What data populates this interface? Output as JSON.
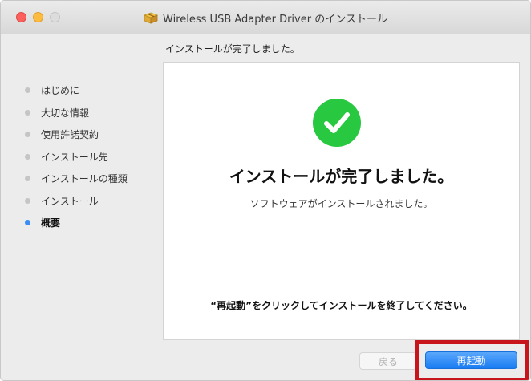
{
  "window": {
    "title": "Wireless USB Adapter Driver のインストール"
  },
  "header": {
    "text": "インストールが完了しました。"
  },
  "sidebar": {
    "items": [
      {
        "label": "はじめに",
        "active": false
      },
      {
        "label": "大切な情報",
        "active": false
      },
      {
        "label": "使用許諾契約",
        "active": false
      },
      {
        "label": "インストール先",
        "active": false
      },
      {
        "label": "インストールの種類",
        "active": false
      },
      {
        "label": "インストール",
        "active": false
      },
      {
        "label": "概要",
        "active": true
      }
    ]
  },
  "content": {
    "icon": "green-check-icon",
    "title": "インストールが完了しました。",
    "subtitle": "ソフトウェアがインストールされました。",
    "note": "“再起動”をクリックしてインストールを終了してください。"
  },
  "buttons": {
    "back_label": "戻る",
    "restart_label": "再起動"
  },
  "colors": {
    "accent": "#1a7cf3",
    "success": "#28c840",
    "highlight": "#c8151b",
    "active_dot": "#3b8df5"
  }
}
